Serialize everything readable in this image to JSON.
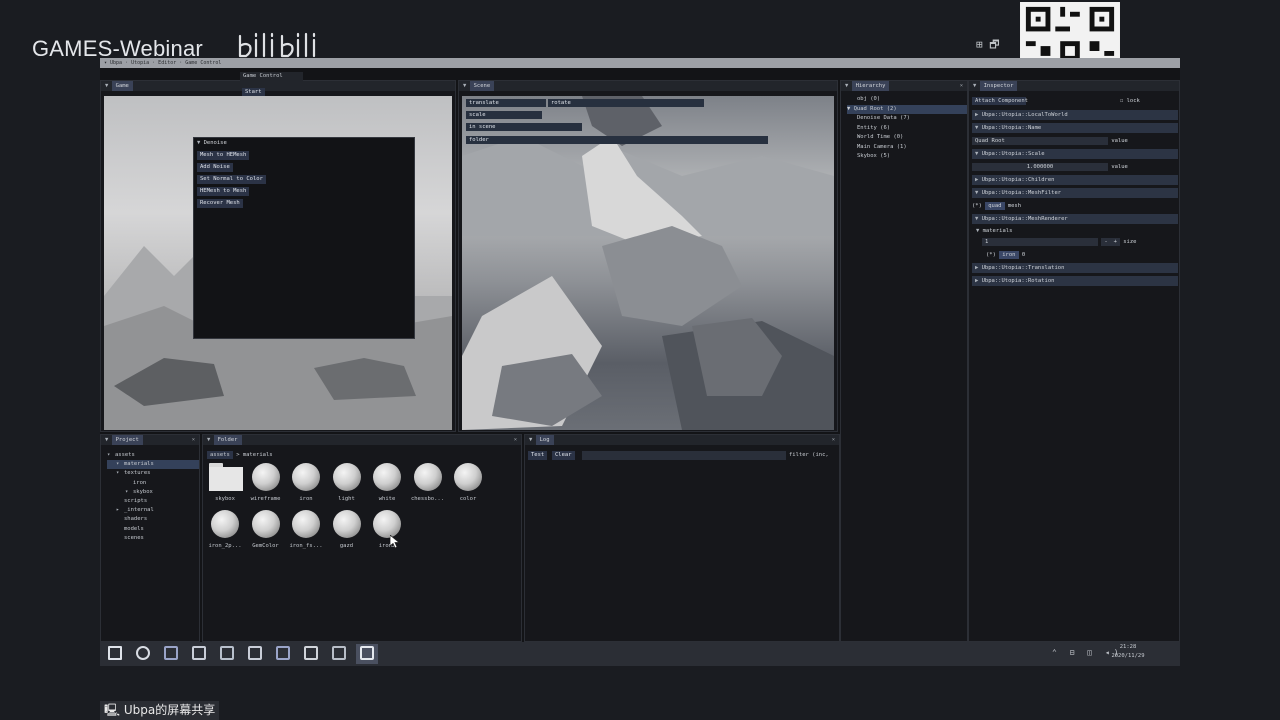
{
  "overlay": {
    "brand": "GAMES-Webinar",
    "bilibili_logo": "bilibili",
    "share_label": "Ubpa的屏幕共享",
    "top_icons": "⊞ 🗗"
  },
  "menubar": "▾ Ubpa · Utopia · Editor · Game Control",
  "game_panel": {
    "title": "Game",
    "game_control": "Game Control",
    "start_label": "Start"
  },
  "denoise": {
    "title": "Denoise",
    "buttons": [
      "Mesh to HEMesh",
      "Add Noise",
      "Set Normal to Color",
      "HEMesh to Mesh",
      "Recover Mesh"
    ]
  },
  "scene_panel": {
    "title": "Scene",
    "buttons": [
      "translate",
      "rotate",
      "scale",
      "in scene",
      "folder"
    ]
  },
  "hierarchy": {
    "title": "Hierarchy",
    "items": [
      {
        "label": "obj (0)",
        "indent": 1,
        "selected": false
      },
      {
        "label": "Quad Root (2)",
        "indent": 0,
        "selected": true
      },
      {
        "label": "Denoise Data (7)",
        "indent": 1,
        "selected": false
      },
      {
        "label": "Entity (6)",
        "indent": 1,
        "selected": false
      },
      {
        "label": "World Time (0)",
        "indent": 1,
        "selected": false
      },
      {
        "label": "Main Camera (1)",
        "indent": 1,
        "selected": false
      },
      {
        "label": "Skybox (5)",
        "indent": 1,
        "selected": false
      }
    ]
  },
  "inspector": {
    "title": "Inspector",
    "attach_label": "Attach Component",
    "lock_label": "lock",
    "components": {
      "local_to_world": "Ubpa::Utopia::LocalToWorld",
      "name": "Ubpa::Utopia::Name",
      "name_value": "Quad Root",
      "value_label": "value",
      "scale": "Ubpa::Utopia::Scale",
      "scale_value": "1.000000",
      "children": "Ubpa::Utopia::Children",
      "mesh_filter": "Ubpa::Utopia::MeshFilter",
      "mesh_flag": "(*)",
      "mesh_name": "quad",
      "mesh_label": "mesh",
      "mesh_renderer": "Ubpa::Utopia::MeshRenderer",
      "materials_label": "materials",
      "materials_count": "1",
      "size_label": "size",
      "item_flag": "(*)",
      "item_name": "iron",
      "item_index": "0",
      "translation": "Ubpa::Utopia::Translation",
      "rotation": "Ubpa::Utopia::Rotation"
    }
  },
  "project": {
    "title": "Project",
    "tree": [
      {
        "label": "assets",
        "indent": 0,
        "arrow": "▾",
        "selected": false
      },
      {
        "label": "materials",
        "indent": 1,
        "arrow": "▾",
        "selected": true
      },
      {
        "label": "textures",
        "indent": 1,
        "arrow": "▾",
        "selected": false
      },
      {
        "label": "iron",
        "indent": 2,
        "arrow": "",
        "selected": false
      },
      {
        "label": "skybox",
        "indent": 2,
        "arrow": "▾",
        "selected": false
      },
      {
        "label": "scripts",
        "indent": 1,
        "arrow": "",
        "selected": false
      },
      {
        "label": "_internal",
        "indent": 1,
        "arrow": "▸",
        "selected": false
      },
      {
        "label": "shaders",
        "indent": 1,
        "arrow": "",
        "selected": false
      },
      {
        "label": "models",
        "indent": 1,
        "arrow": "",
        "selected": false
      },
      {
        "label": "scenes",
        "indent": 1,
        "arrow": "",
        "selected": false
      }
    ]
  },
  "folder": {
    "title": "Folder",
    "path_root": "assets",
    "path_sep": ">",
    "path_leaf": "materials",
    "assets": [
      {
        "label": "skybox",
        "kind": "folder"
      },
      {
        "label": "wireframe",
        "kind": "material"
      },
      {
        "label": "iron",
        "kind": "material"
      },
      {
        "label": "light",
        "kind": "material"
      },
      {
        "label": "white",
        "kind": "material"
      },
      {
        "label": "chessbo...",
        "kind": "material"
      },
      {
        "label": "color",
        "kind": "material"
      },
      {
        "label": "iron_2p...",
        "kind": "material"
      },
      {
        "label": "GemColor",
        "kind": "material"
      },
      {
        "label": "iron_fs...",
        "kind": "material"
      },
      {
        "label": "gazd",
        "kind": "material"
      },
      {
        "label": "iron2",
        "kind": "material"
      }
    ]
  },
  "log": {
    "title": "Log",
    "test_label": "Test",
    "clear_label": "Clear",
    "filter_label": "filter (inc,"
  },
  "taskbar": {
    "time": "21:28",
    "date": "2020/11/29",
    "apps": [
      "windows-start-icon",
      "chrome-icon",
      "visual-studio-icon",
      "photos-icon",
      "unity-icon",
      "git-icon",
      "visual-studio-2-icon",
      "notes-icon",
      "explorer-icon",
      "terminal-icon"
    ]
  }
}
